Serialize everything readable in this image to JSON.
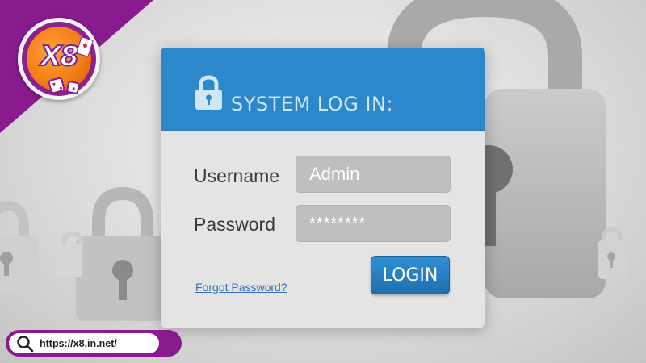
{
  "brand": {
    "logo_text": "X8",
    "url": "https://x8.in.net/"
  },
  "dialog": {
    "title": "SYSTEM LOG IN:",
    "username_label": "Username",
    "username_value": "Admin",
    "password_label": "Password",
    "password_value": "********",
    "forgot_link": "Forgot Password?",
    "login_button": "LOGIN"
  },
  "icons": {
    "dialog_icon": "lock-icon",
    "url_icon": "search-icon",
    "background": "padlock-icon"
  },
  "colors": {
    "header_blue": "#2d88cb",
    "brand_purple": "#8a1b8f",
    "logo_orange": "#f07a12",
    "field_gray": "#bfbfbf",
    "link_blue": "#2f6fbe"
  }
}
